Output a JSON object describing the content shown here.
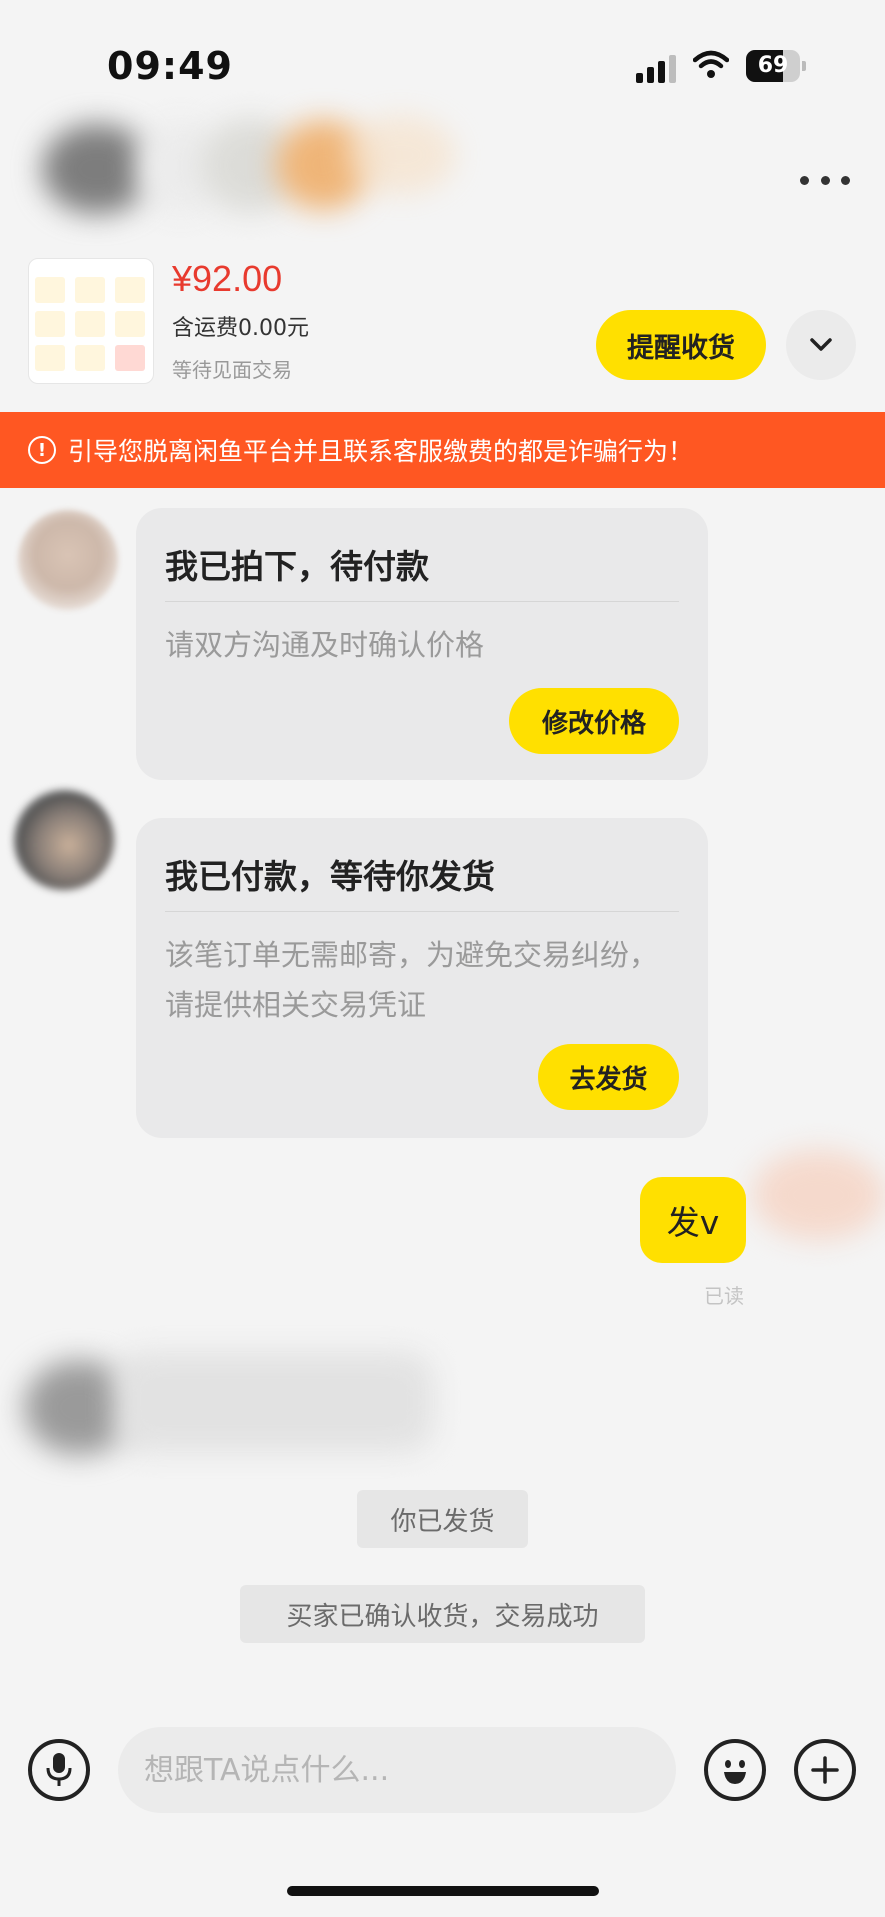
{
  "status_bar": {
    "time": "09:49",
    "battery": "69",
    "battery_level": 0.69
  },
  "product": {
    "price": "¥92.00",
    "shipping": "含运费0.00元",
    "trade_status": "等待见面交易",
    "remind_button": "提醒收货"
  },
  "warning": {
    "icon": "!",
    "text": "引导您脱离闲鱼平台并且联系客服缴费的都是诈骗行为！"
  },
  "messages": [
    {
      "title": "我已拍下，待付款",
      "body": "请双方沟通及时确认价格",
      "button": "修改价格"
    },
    {
      "title": "我已付款，等待你发货",
      "body": "该笔订单无需邮寄，为避免交易纠纷，请提供相关交易凭证",
      "button": "去发货"
    }
  ],
  "my_message": {
    "text": "发v",
    "read_status": "已读"
  },
  "system_messages": [
    "你已发货",
    "买家已确认收货，交易成功"
  ],
  "input": {
    "placeholder": "想跟TA说点什么..."
  },
  "colors": {
    "accent": "#ffe000",
    "warning": "#ff5722",
    "price": "#e83a2e"
  }
}
